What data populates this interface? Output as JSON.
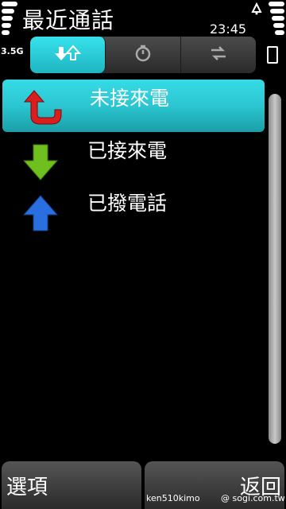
{
  "status": {
    "network": "3.5G",
    "time": "23:45"
  },
  "header": {
    "title": "最近通話"
  },
  "tabs": [
    {
      "icon": "missed-received-arrows-icon",
      "active": true
    },
    {
      "icon": "timer-icon",
      "active": false
    },
    {
      "icon": "swap-arrows-icon",
      "active": false
    }
  ],
  "list": {
    "items": [
      {
        "label": "未接來電",
        "icon": "missed-call-icon",
        "selected": true
      },
      {
        "label": "已接來電",
        "icon": "received-call-icon",
        "selected": false
      },
      {
        "label": "已撥電話",
        "icon": "dialed-call-icon",
        "selected": false
      }
    ]
  },
  "softkeys": {
    "left": "選項",
    "right": "返回"
  },
  "watermark": {
    "user": "ken510kimo",
    "site": "@ sogi.com.tw"
  },
  "colors": {
    "accent": "#2bc6d1",
    "missed": "#d81e1e",
    "received": "#6fbf1f",
    "dialed": "#2a6fe0"
  }
}
